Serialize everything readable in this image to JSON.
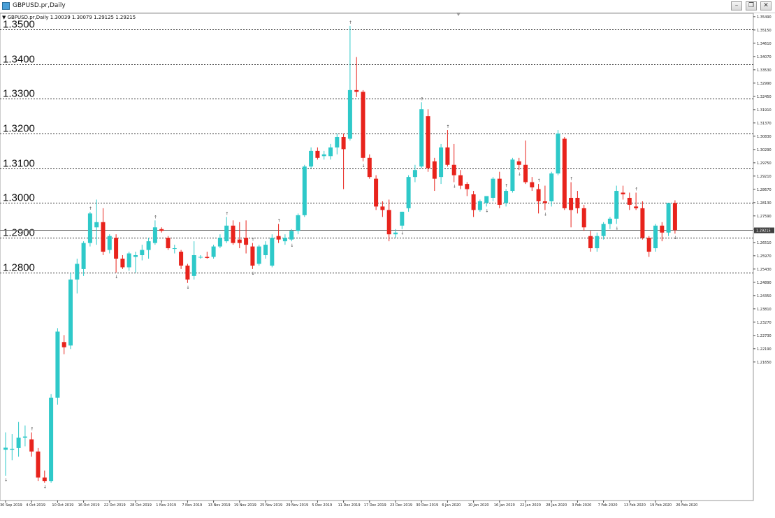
{
  "window": {
    "title": "GBPUSD.pr,Daily",
    "info_line": "▼ GBPUSD.pr,Daily  1.30039 1.30079 1.29125 1.29215",
    "buttons": {
      "minimize": "–",
      "restore": "❐",
      "close": "✕"
    }
  },
  "colors": {
    "bull": "#2ec9c9",
    "bear": "#e8231c",
    "grid": "#333333",
    "current_price_tag": "#404040",
    "fractal": "#666666"
  },
  "chart_data": {
    "type": "candlestick",
    "symbol": "GBPUSD.pr",
    "timeframe": "Daily",
    "ylim": [
      1.2144,
      1.3546
    ],
    "levels": [
      {
        "value": 1.35,
        "label": "1.3500"
      },
      {
        "value": 1.34,
        "label": "1.3400"
      },
      {
        "value": 1.33,
        "label": "1.3300"
      },
      {
        "value": 1.32,
        "label": "1.3200"
      },
      {
        "value": 1.31,
        "label": "1.3100"
      },
      {
        "value": 1.3,
        "label": "1.3000"
      },
      {
        "value": 1.29,
        "label": "1.2900"
      },
      {
        "value": 1.28,
        "label": "1.2800"
      }
    ],
    "current_price": 1.2922,
    "current_price_label": "1.29215",
    "y_ticks": [
      {
        "value": 1.35362,
        "label": "1.35490"
      },
      {
        "value": 1.3498,
        "label": "1.35150"
      },
      {
        "value": 1.34598,
        "label": "1.34610"
      },
      {
        "value": 1.34216,
        "label": "1.34070"
      },
      {
        "value": 1.33834,
        "label": "1.33530"
      },
      {
        "value": 1.33451,
        "label": "1.32990"
      },
      {
        "value": 1.33069,
        "label": "1.32450"
      },
      {
        "value": 1.32687,
        "label": "1.31910"
      },
      {
        "value": 1.32305,
        "label": "1.31370"
      },
      {
        "value": 1.31923,
        "label": "1.30830"
      },
      {
        "value": 1.31541,
        "label": "1.30290"
      },
      {
        "value": 1.31158,
        "label": "1.29750"
      },
      {
        "value": 1.30776,
        "label": "1.29210"
      },
      {
        "value": 1.30394,
        "label": "1.28670"
      },
      {
        "value": 1.30012,
        "label": "1.28130"
      },
      {
        "value": 1.2963,
        "label": "1.27590"
      },
      {
        "value": 1.29248,
        "label": "1.27050"
      },
      {
        "value": 1.28865,
        "label": "1.26510"
      },
      {
        "value": 1.28483,
        "label": "1.25970"
      },
      {
        "value": 1.28101,
        "label": "1.25430"
      },
      {
        "value": 1.27719,
        "label": "1.24890"
      },
      {
        "value": 1.27337,
        "label": "1.24350"
      },
      {
        "value": 1.26955,
        "label": "1.23810"
      },
      {
        "value": 1.26572,
        "label": "1.23270"
      },
      {
        "value": 1.2619,
        "label": "1.22730"
      },
      {
        "value": 1.25808,
        "label": "1.22190"
      },
      {
        "value": 1.25426,
        "label": "1.21650"
      }
    ],
    "x_labels": [
      {
        "index": 0,
        "label": "30 Sep 2019"
      },
      {
        "index": 4,
        "label": "4 Oct 2019"
      },
      {
        "index": 8,
        "label": "10 Oct 2019"
      },
      {
        "index": 12,
        "label": "16 Oct 2019"
      },
      {
        "index": 16,
        "label": "22 Oct 2019"
      },
      {
        "index": 20,
        "label": "28 Oct 2019"
      },
      {
        "index": 24,
        "label": "1 Nov 2019"
      },
      {
        "index": 28,
        "label": "7 Nov 2019"
      },
      {
        "index": 32,
        "label": "13 Nov 2019"
      },
      {
        "index": 36,
        "label": "19 Nov 2019"
      },
      {
        "index": 40,
        "label": "25 Nov 2019"
      },
      {
        "index": 44,
        "label": "29 Nov 2019"
      },
      {
        "index": 48,
        "label": "5 Dec 2019"
      },
      {
        "index": 52,
        "label": "11 Dec 2019"
      },
      {
        "index": 56,
        "label": "17 Dec 2019"
      },
      {
        "index": 60,
        "label": "23 Dec 2019"
      },
      {
        "index": 64,
        "label": "30 Dec 2019"
      },
      {
        "index": 68,
        "label": "6 Jan 2020"
      },
      {
        "index": 72,
        "label": "10 Jan 2020"
      },
      {
        "index": 76,
        "label": "16 Jan 2020"
      },
      {
        "index": 80,
        "label": "22 Jan 2020"
      },
      {
        "index": 84,
        "label": "28 Jan 2020"
      },
      {
        "index": 88,
        "label": "3 Feb 2020"
      },
      {
        "index": 92,
        "label": "7 Feb 2020"
      },
      {
        "index": 96,
        "label": "13 Feb 2020"
      },
      {
        "index": 100,
        "label": "19 Feb 2020"
      },
      {
        "index": 104,
        "label": "26 Feb 2020"
      }
    ],
    "candles": [
      {
        "o": 1.229,
        "h": 1.234,
        "l": 1.2215,
        "c": 1.2296
      },
      {
        "o": 1.229,
        "h": 1.2335,
        "l": 1.226,
        "c": 1.2293
      },
      {
        "o": 1.2295,
        "h": 1.237,
        "l": 1.227,
        "c": 1.2325
      },
      {
        "o": 1.2325,
        "h": 1.236,
        "l": 1.23,
        "c": 1.2328
      },
      {
        "o": 1.232,
        "h": 1.234,
        "l": 1.227,
        "c": 1.2285
      },
      {
        "o": 1.2285,
        "h": 1.2295,
        "l": 1.22,
        "c": 1.221
      },
      {
        "o": 1.221,
        "h": 1.223,
        "l": 1.2195,
        "c": 1.22
      },
      {
        "o": 1.22,
        "h": 1.245,
        "l": 1.2195,
        "c": 1.244
      },
      {
        "o": 1.244,
        "h": 1.264,
        "l": 1.242,
        "c": 1.263
      },
      {
        "o": 1.26,
        "h": 1.262,
        "l": 1.2565,
        "c": 1.2585
      },
      {
        "o": 1.259,
        "h": 1.28,
        "l": 1.258,
        "c": 1.278
      },
      {
        "o": 1.278,
        "h": 1.284,
        "l": 1.274,
        "c": 1.2825
      },
      {
        "o": 1.281,
        "h": 1.289,
        "l": 1.279,
        "c": 1.2885
      },
      {
        "o": 1.2885,
        "h": 1.2975,
        "l": 1.2875,
        "c": 1.297
      },
      {
        "o": 1.293,
        "h": 1.301,
        "l": 1.288,
        "c": 1.2945
      },
      {
        "o": 1.2945,
        "h": 1.2985,
        "l": 1.285,
        "c": 1.286
      },
      {
        "o": 1.2865,
        "h": 1.291,
        "l": 1.2855,
        "c": 1.2905
      },
      {
        "o": 1.29,
        "h": 1.291,
        "l": 1.28,
        "c": 1.284
      },
      {
        "o": 1.284,
        "h": 1.285,
        "l": 1.281,
        "c": 1.2815
      },
      {
        "o": 1.2815,
        "h": 1.286,
        "l": 1.2805,
        "c": 1.2855
      },
      {
        "o": 1.2845,
        "h": 1.286,
        "l": 1.28,
        "c": 1.285
      },
      {
        "o": 1.285,
        "h": 1.288,
        "l": 1.2835,
        "c": 1.2865
      },
      {
        "o": 1.2865,
        "h": 1.29,
        "l": 1.284,
        "c": 1.289
      },
      {
        "o": 1.2885,
        "h": 1.295,
        "l": 1.288,
        "c": 1.293
      },
      {
        "o": 1.2925,
        "h": 1.293,
        "l": 1.2915,
        "c": 1.292
      },
      {
        "o": 1.29,
        "h": 1.2905,
        "l": 1.2865,
        "c": 1.287
      },
      {
        "o": 1.287,
        "h": 1.288,
        "l": 1.2855,
        "c": 1.287
      },
      {
        "o": 1.286,
        "h": 1.2865,
        "l": 1.281,
        "c": 1.282
      },
      {
        "o": 1.282,
        "h": 1.2825,
        "l": 1.277,
        "c": 1.278
      },
      {
        "o": 1.279,
        "h": 1.289,
        "l": 1.278,
        "c": 1.285
      },
      {
        "o": 1.2845,
        "h": 1.285,
        "l": 1.284,
        "c": 1.2845
      },
      {
        "o": 1.2845,
        "h": 1.286,
        "l": 1.284,
        "c": 1.2842
      },
      {
        "o": 1.2845,
        "h": 1.288,
        "l": 1.284,
        "c": 1.2875
      },
      {
        "o": 1.2875,
        "h": 1.291,
        "l": 1.287,
        "c": 1.29
      },
      {
        "o": 1.289,
        "h": 1.296,
        "l": 1.2885,
        "c": 1.2935
      },
      {
        "o": 1.2935,
        "h": 1.295,
        "l": 1.288,
        "c": 1.2885
      },
      {
        "o": 1.2895,
        "h": 1.2945,
        "l": 1.287,
        "c": 1.2885
      },
      {
        "o": 1.29,
        "h": 1.295,
        "l": 1.2855,
        "c": 1.288
      },
      {
        "o": 1.2875,
        "h": 1.2885,
        "l": 1.281,
        "c": 1.282
      },
      {
        "o": 1.2825,
        "h": 1.288,
        "l": 1.282,
        "c": 1.2875
      },
      {
        "o": 1.285,
        "h": 1.289,
        "l": 1.284,
        "c": 1.288
      },
      {
        "o": 1.282,
        "h": 1.291,
        "l": 1.2815,
        "c": 1.29
      },
      {
        "o": 1.2905,
        "h": 1.294,
        "l": 1.2885,
        "c": 1.2895
      },
      {
        "o": 1.289,
        "h": 1.291,
        "l": 1.288,
        "c": 1.29
      },
      {
        "o": 1.2895,
        "h": 1.2925,
        "l": 1.289,
        "c": 1.292
      },
      {
        "o": 1.292,
        "h": 1.297,
        "l": 1.291,
        "c": 1.2965
      },
      {
        "o": 1.2965,
        "h": 1.311,
        "l": 1.296,
        "c": 1.3105
      },
      {
        "o": 1.3105,
        "h": 1.316,
        "l": 1.31,
        "c": 1.315
      },
      {
        "o": 1.315,
        "h": 1.316,
        "l": 1.3125,
        "c": 1.313
      },
      {
        "o": 1.3135,
        "h": 1.315,
        "l": 1.3125,
        "c": 1.314
      },
      {
        "o": 1.3135,
        "h": 1.317,
        "l": 1.3125,
        "c": 1.316
      },
      {
        "o": 1.316,
        "h": 1.32,
        "l": 1.314,
        "c": 1.319
      },
      {
        "o": 1.319,
        "h": 1.32,
        "l": 1.304,
        "c": 1.3155
      },
      {
        "o": 1.3185,
        "h": 1.351,
        "l": 1.318,
        "c": 1.3325
      },
      {
        "o": 1.3325,
        "h": 1.342,
        "l": 1.3305,
        "c": 1.332
      },
      {
        "o": 1.332,
        "h": 1.3325,
        "l": 1.312,
        "c": 1.313
      },
      {
        "o": 1.313,
        "h": 1.314,
        "l": 1.307,
        "c": 1.3075
      },
      {
        "o": 1.307,
        "h": 1.308,
        "l": 1.298,
        "c": 1.299
      },
      {
        "o": 1.299,
        "h": 1.3005,
        "l": 1.296,
        "c": 1.298
      },
      {
        "o": 1.298,
        "h": 1.301,
        "l": 1.289,
        "c": 1.291
      },
      {
        "o": 1.291,
        "h": 1.2925,
        "l": 1.29,
        "c": 1.2915
      },
      {
        "o": 1.2935,
        "h": 1.2975,
        "l": 1.2925,
        "c": 1.2975
      },
      {
        "o": 1.2985,
        "h": 1.308,
        "l": 1.2975,
        "c": 1.3075
      },
      {
        "o": 1.3075,
        "h": 1.311,
        "l": 1.306,
        "c": 1.3095
      },
      {
        "o": 1.3105,
        "h": 1.329,
        "l": 1.31,
        "c": 1.327
      },
      {
        "o": 1.325,
        "h": 1.327,
        "l": 1.309,
        "c": 1.31
      },
      {
        "o": 1.312,
        "h": 1.313,
        "l": 1.3035,
        "c": 1.307
      },
      {
        "o": 1.3075,
        "h": 1.317,
        "l": 1.3055,
        "c": 1.316
      },
      {
        "o": 1.316,
        "h": 1.321,
        "l": 1.3105,
        "c": 1.311
      },
      {
        "o": 1.311,
        "h": 1.317,
        "l": 1.306,
        "c": 1.308
      },
      {
        "o": 1.308,
        "h": 1.3095,
        "l": 1.304,
        "c": 1.305
      },
      {
        "o": 1.3055,
        "h": 1.306,
        "l": 1.302,
        "c": 1.304
      },
      {
        "o": 1.3025,
        "h": 1.3035,
        "l": 1.296,
        "c": 1.298
      },
      {
        "o": 1.298,
        "h": 1.301,
        "l": 1.2975,
        "c": 1.3005
      },
      {
        "o": 1.3,
        "h": 1.302,
        "l": 1.299,
        "c": 1.302
      },
      {
        "o": 1.3015,
        "h": 1.3075,
        "l": 1.3005,
        "c": 1.307
      },
      {
        "o": 1.307,
        "h": 1.309,
        "l": 1.2985,
        "c": 1.2995
      },
      {
        "o": 1.3,
        "h": 1.304,
        "l": 1.299,
        "c": 1.3035
      },
      {
        "o": 1.3035,
        "h": 1.313,
        "l": 1.303,
        "c": 1.3125
      },
      {
        "o": 1.312,
        "h": 1.313,
        "l": 1.3095,
        "c": 1.311
      },
      {
        "o": 1.311,
        "h": 1.318,
        "l": 1.3055,
        "c": 1.306
      },
      {
        "o": 1.306,
        "h": 1.3075,
        "l": 1.3035,
        "c": 1.3045
      },
      {
        "o": 1.304,
        "h": 1.3055,
        "l": 1.297,
        "c": 1.3005
      },
      {
        "o": 1.3005,
        "h": 1.305,
        "l": 1.298,
        "c": 1.3
      },
      {
        "o": 1.3005,
        "h": 1.309,
        "l": 1.299,
        "c": 1.3085
      },
      {
        "o": 1.3085,
        "h": 1.321,
        "l": 1.308,
        "c": 1.32
      },
      {
        "o": 1.3185,
        "h": 1.319,
        "l": 1.298,
        "c": 1.2985
      },
      {
        "o": 1.3015,
        "h": 1.306,
        "l": 1.293,
        "c": 1.298
      },
      {
        "o": 1.3015,
        "h": 1.3035,
        "l": 1.297,
        "c": 1.2985
      },
      {
        "o": 1.2985,
        "h": 1.2995,
        "l": 1.292,
        "c": 1.293
      },
      {
        "o": 1.2905,
        "h": 1.292,
        "l": 1.286,
        "c": 1.287
      },
      {
        "o": 1.287,
        "h": 1.2915,
        "l": 1.286,
        "c": 1.2905
      },
      {
        "o": 1.2905,
        "h": 1.2945,
        "l": 1.2895,
        "c": 1.294
      },
      {
        "o": 1.294,
        "h": 1.296,
        "l": 1.2925,
        "c": 1.2955
      },
      {
        "o": 1.2955,
        "h": 1.305,
        "l": 1.294,
        "c": 1.3035
      },
      {
        "o": 1.303,
        "h": 1.305,
        "l": 1.301,
        "c": 1.3025
      },
      {
        "o": 1.3015,
        "h": 1.303,
        "l": 1.298,
        "c": 1.2995
      },
      {
        "o": 1.299,
        "h": 1.303,
        "l": 1.298,
        "c": 1.2985
      },
      {
        "o": 1.2985,
        "h": 1.3005,
        "l": 1.2895,
        "c": 1.29
      },
      {
        "o": 1.29,
        "h": 1.2905,
        "l": 1.2845,
        "c": 1.286
      },
      {
        "o": 1.287,
        "h": 1.294,
        "l": 1.286,
        "c": 1.2935
      },
      {
        "o": 1.2935,
        "h": 1.2945,
        "l": 1.289,
        "c": 1.2915
      },
      {
        "o": 1.2915,
        "h": 1.3,
        "l": 1.2905,
        "c": 1.3
      },
      {
        "o": 1.3,
        "h": 1.3008,
        "l": 1.2912,
        "c": 1.2922
      }
    ],
    "fractals_up": [
      4,
      13,
      23,
      34,
      38,
      42,
      53,
      64,
      68,
      77,
      82,
      87,
      97
    ],
    "fractals_down": [
      0,
      6,
      17,
      28,
      38,
      44,
      55,
      61,
      69,
      74,
      79,
      83,
      94,
      103
    ]
  }
}
